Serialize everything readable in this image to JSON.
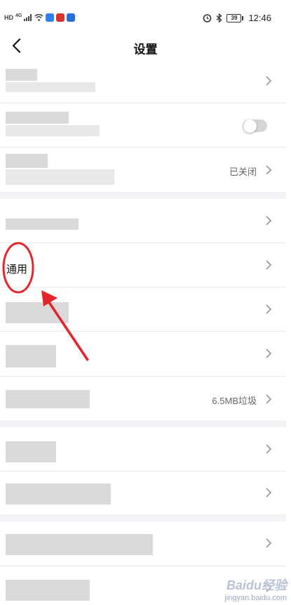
{
  "status_bar": {
    "network": "HD",
    "signal_label": "4G",
    "battery": "39",
    "time": "12:46"
  },
  "header": {
    "title": "设置",
    "back_icon": "chevron-left-icon"
  },
  "rows": {
    "row3_value": "已关闭",
    "general_label": "通用",
    "cache_value": "6.5MB垃圾"
  },
  "watermark": {
    "brand": "Baidu经验",
    "url": "jingyan.baidu.com"
  },
  "colors": {
    "annotation_red": "#e3262c",
    "section_gap": "#f1f3f6",
    "toggle_off": "#d6d6d6"
  }
}
